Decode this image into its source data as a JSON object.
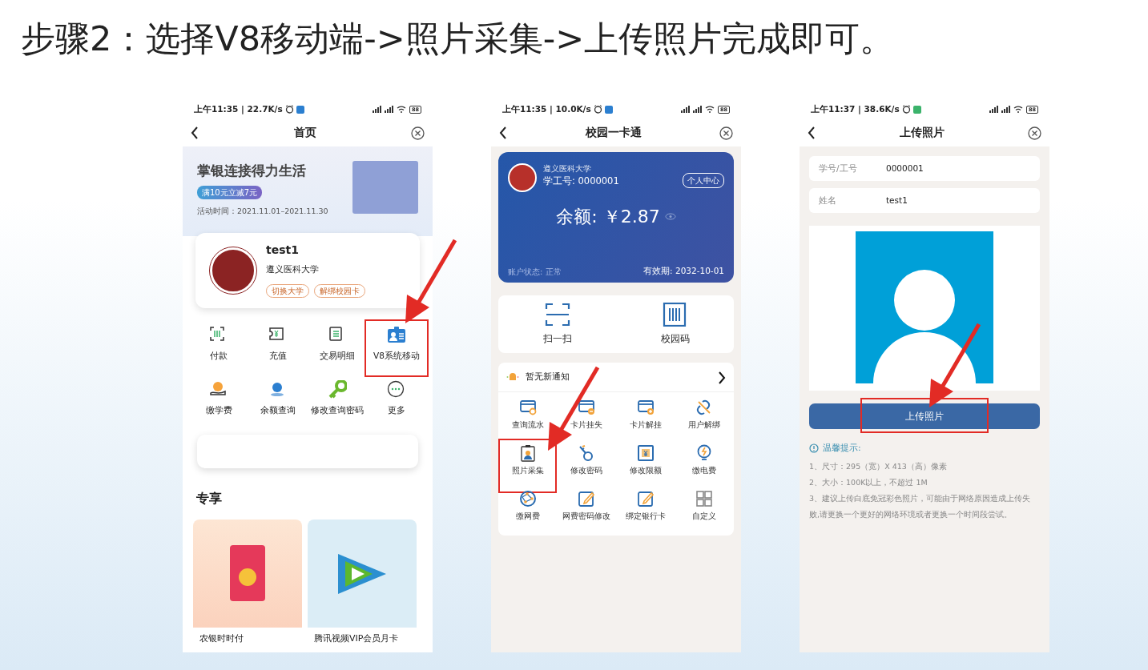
{
  "heading": "步骤2：选择V8移动端->照片采集->上传照片完成即可。",
  "phones": [
    {
      "kind": "home",
      "status": {
        "time": "上午11:35 | 22.7K/s",
        "battery": "88"
      },
      "title": "首页",
      "banner": {
        "title": "掌银连接得力生活",
        "tag": "满10元立减7元",
        "period": "活动时间：2021.11.01–2021.11.30"
      },
      "profile": {
        "name": "test1",
        "school": "遵义医科大学",
        "tags": [
          "切换大学",
          "解绑校园卡"
        ]
      },
      "shortcuts": [
        {
          "label": "付款",
          "highlighted": false
        },
        {
          "label": "充值",
          "highlighted": false
        },
        {
          "label": "交易明细",
          "highlighted": false
        },
        {
          "label": "V8系统移动",
          "highlighted": true
        },
        {
          "label": "缴学费",
          "highlighted": false
        },
        {
          "label": "余额查询",
          "highlighted": false
        },
        {
          "label": "修改查询密码",
          "highlighted": false
        },
        {
          "label": "更多",
          "highlighted": false
        }
      ],
      "section_title": "专享",
      "promos": [
        {
          "label": "农银时时付"
        },
        {
          "label": "腾讯视频VIP会员月卡"
        }
      ]
    },
    {
      "kind": "card",
      "status": {
        "time": "上午11:35 | 10.0K/s",
        "battery": "88"
      },
      "title": "校园一卡通",
      "card": {
        "school": "遵义医科大学",
        "id": "学工号: 0000001",
        "center_button": "个人中心",
        "balance": "余额: ￥2.87",
        "account_status": "账户状态: 正常",
        "expiry": "有效期: 2032-10-01"
      },
      "quick": [
        {
          "label": "扫一扫"
        },
        {
          "label": "校园码"
        }
      ],
      "notice": "暂无新通知",
      "services": [
        {
          "label": "查询流水",
          "highlighted": false
        },
        {
          "label": "卡片挂失",
          "highlighted": false
        },
        {
          "label": "卡片解挂",
          "highlighted": false
        },
        {
          "label": "用户解绑",
          "highlighted": false
        },
        {
          "label": "照片采集",
          "highlighted": true
        },
        {
          "label": "修改密码",
          "highlighted": false
        },
        {
          "label": "修改限额",
          "highlighted": false
        },
        {
          "label": "缴电费",
          "highlighted": false
        },
        {
          "label": "缴网费",
          "highlighted": false
        },
        {
          "label": "网费密码修改",
          "highlighted": false
        },
        {
          "label": "绑定银行卡",
          "highlighted": false
        },
        {
          "label": "自定义",
          "highlighted": false
        }
      ]
    },
    {
      "kind": "upload",
      "status": {
        "time": "上午11:37 | 38.6K/s",
        "battery": "88"
      },
      "title": "上传照片",
      "fields": [
        {
          "label": "学号/工号",
          "value": "0000001"
        },
        {
          "label": "姓名",
          "value": "test1"
        }
      ],
      "upload_button": {
        "label": "上传照片",
        "highlighted": true
      },
      "tips_title": "温馨提示:",
      "tips": [
        "1、尺寸：295（宽）X 413（高）像素",
        "2、大小：100K以上，不超过 1M",
        "3、建议上传白底免冠彩色照片，可能由于网络原因造成上传失败,请更换一个更好的网络环境或者更换一个时间段尝试。"
      ]
    }
  ]
}
